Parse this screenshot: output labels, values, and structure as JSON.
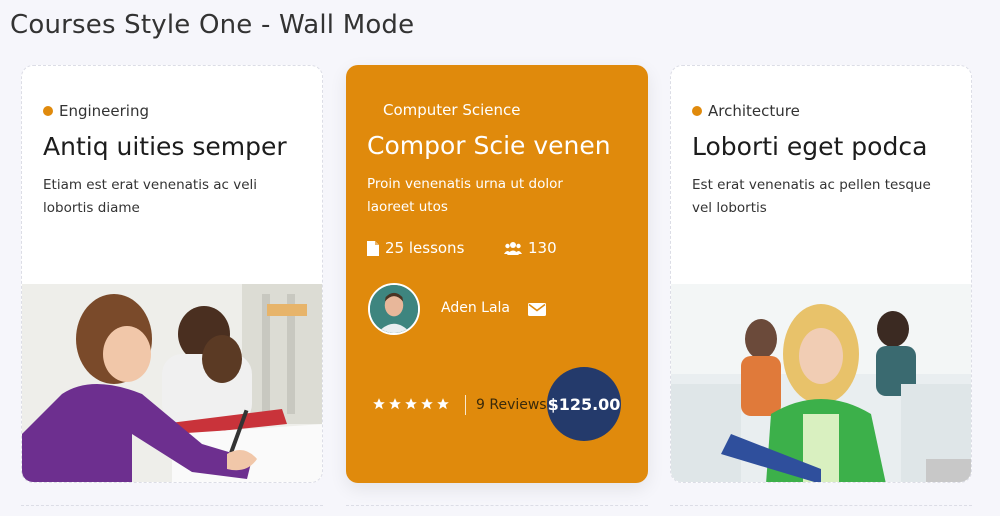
{
  "page": {
    "title": "Courses Style One - Wall Mode"
  },
  "cards": [
    {
      "category": "Engineering",
      "title": "Antiq uities semper",
      "description": "Etiam est erat venenatis ac veli lobortis diame",
      "image": "students-writing-photo"
    },
    {
      "category": "Computer Science",
      "title": "Compor Scie venen",
      "description": "Proin venenatis urna ut dolor laoreet utos",
      "lessons": "25 lessons",
      "students": "130",
      "instructor": "Aden Lala",
      "rating": 5,
      "reviews": "9 Reviews",
      "price": "$125.00",
      "colors": {
        "background": "#e08a0c",
        "price_badge": "#243a6b"
      }
    },
    {
      "category": "Architecture",
      "title": "Loborti eget podca",
      "description": "Est erat venenatis ac pellen tesque vel lobortis",
      "image": "smiling-student-with-book-photo"
    }
  ],
  "colors": {
    "accent": "#e08a0c",
    "page_bg": "#f6f6fb"
  }
}
